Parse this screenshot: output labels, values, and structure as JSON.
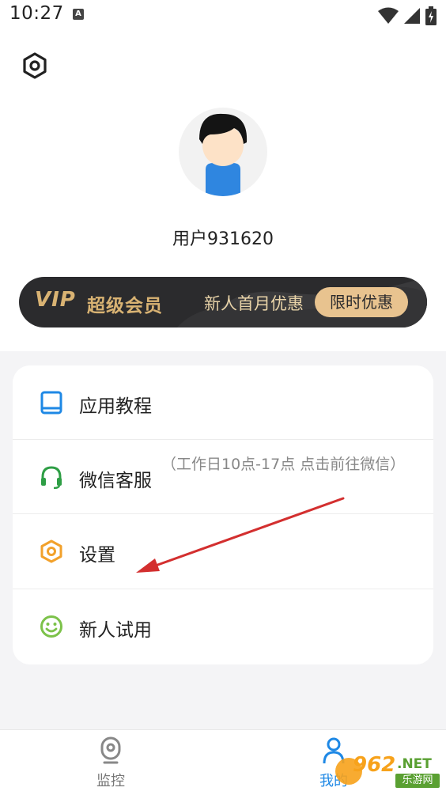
{
  "status_bar": {
    "time": "10:27",
    "notification_icon": "accessibility-a-icon",
    "icons": [
      "wifi-icon",
      "signal-icon",
      "battery-charging-icon"
    ]
  },
  "profile": {
    "settings_icon": "hexagon-settings-icon",
    "username": "用户931620"
  },
  "vip_banner": {
    "logo": "VIP",
    "title": "超级会员",
    "promo": "新人首月优惠",
    "cta": "限时优惠"
  },
  "menu": {
    "items": [
      {
        "label": "应用教程",
        "icon": "book-icon",
        "color": "#1e88e5"
      },
      {
        "label": "微信客服",
        "sub": "（工作日10点-17点 点击前往微信）",
        "icon": "headset-icon",
        "color": "#2e9e45"
      },
      {
        "label": "设置",
        "icon": "hexagon-settings-icon",
        "color": "#f2a12b"
      },
      {
        "label": "新人试用",
        "icon": "smile-icon",
        "color": "#7cc24a"
      }
    ]
  },
  "bottom_nav": {
    "tabs": [
      {
        "label": "监控",
        "icon": "camera-icon",
        "active": false
      },
      {
        "label": "我的",
        "icon": "person-icon",
        "active": true
      }
    ]
  },
  "watermark": {
    "text": "962",
    "net": ".NET",
    "sub": "乐游网"
  },
  "colors": {
    "accent": "#1e88e5",
    "vip_gold": "#d9b373",
    "vip_bg": "#2b2b2d",
    "arrow": "#d32f2f"
  }
}
